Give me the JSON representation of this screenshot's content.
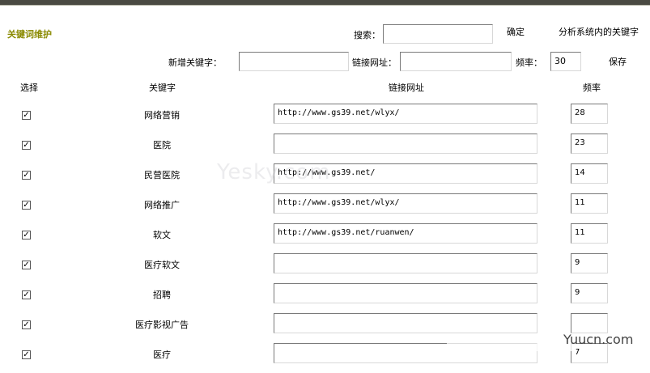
{
  "page": {
    "title": "关键词维护"
  },
  "search": {
    "label": "搜索：",
    "value": "",
    "confirm_label": "确定",
    "analyze_label": "分析系统内的关键字"
  },
  "add_form": {
    "keyword_label": "新增关键字：",
    "keyword_value": "",
    "url_label": "链接网址：",
    "url_value": "",
    "freq_label": "频率：",
    "freq_value": "30",
    "save_label": "保存"
  },
  "table": {
    "headers": {
      "select": "选择",
      "keyword": "关键字",
      "url": "链接网址",
      "freq": "频率"
    },
    "rows": [
      {
        "checked": true,
        "keyword": "网络营销",
        "url": "http://www.gs39.net/wlyx/",
        "freq": "28"
      },
      {
        "checked": true,
        "keyword": "医院",
        "url": "",
        "freq": "23"
      },
      {
        "checked": true,
        "keyword": "民营医院",
        "url": "http://www.gs39.net/",
        "freq": "14"
      },
      {
        "checked": true,
        "keyword": "网络推广",
        "url": "http://www.gs39.net/wlyx/",
        "freq": "11"
      },
      {
        "checked": true,
        "keyword": "软文",
        "url": "http://www.gs39.net/ruanwen/",
        "freq": "11"
      },
      {
        "checked": true,
        "keyword": "医疗软文",
        "url": "",
        "freq": "9"
      },
      {
        "checked": true,
        "keyword": "招聘",
        "url": "",
        "freq": "9"
      },
      {
        "checked": true,
        "keyword": "医疗影视广告",
        "url": "",
        "freq": ""
      },
      {
        "checked": true,
        "keyword": "医疗",
        "url": "",
        "freq": "7"
      }
    ]
  },
  "watermarks": {
    "center": "Yesky.com",
    "corner": "Yuucn.com"
  },
  "colors": {
    "title": "#8a8a00",
    "topbar": "#4a4a42"
  },
  "icons": {
    "check": "checkmark-icon"
  }
}
